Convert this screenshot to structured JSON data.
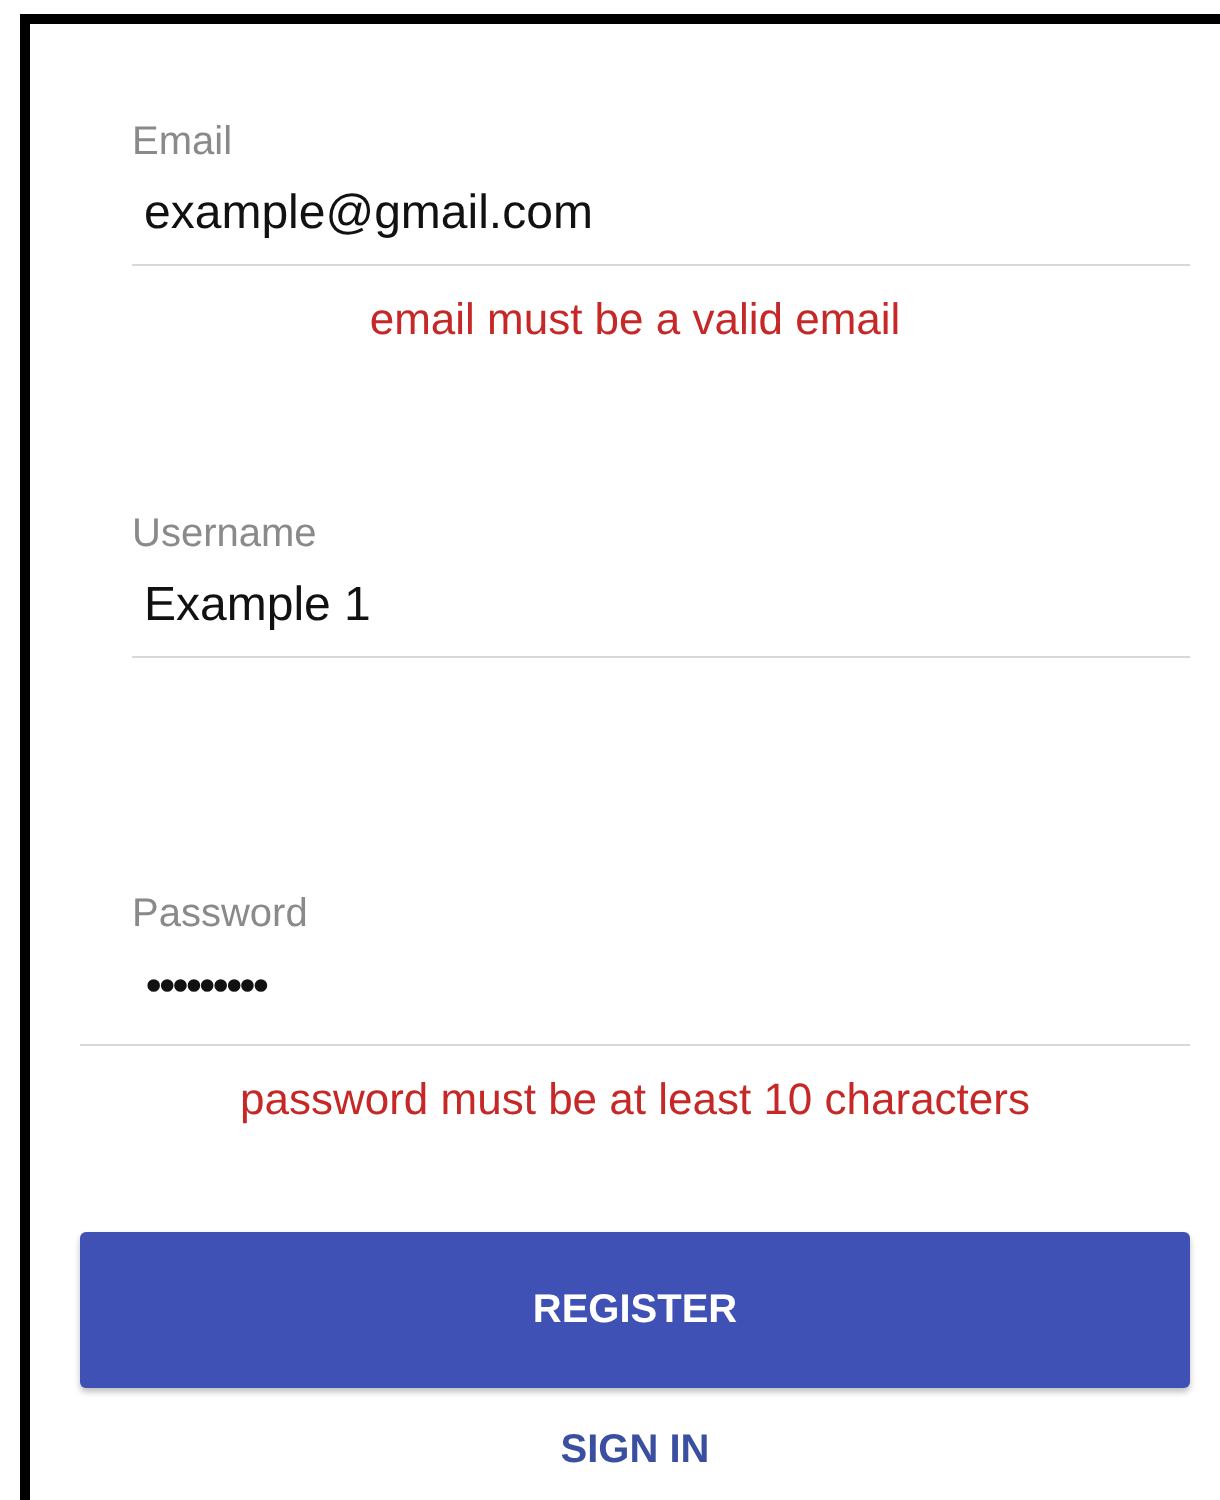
{
  "fields": [
    {
      "kind": "text",
      "label": "Email",
      "value": "example@gmail.com",
      "error": "email must be a valid email"
    },
    {
      "kind": "text",
      "label": "Username",
      "value": "Example 1"
    },
    {
      "kind": "password",
      "label": "Password",
      "value": "•••••••••",
      "error": "password must be at least 10 characters"
    }
  ],
  "buttons": [
    {
      "kind": "primary",
      "label": "REGISTER"
    },
    {
      "kind": "link",
      "label": "SIGN IN"
    }
  ]
}
